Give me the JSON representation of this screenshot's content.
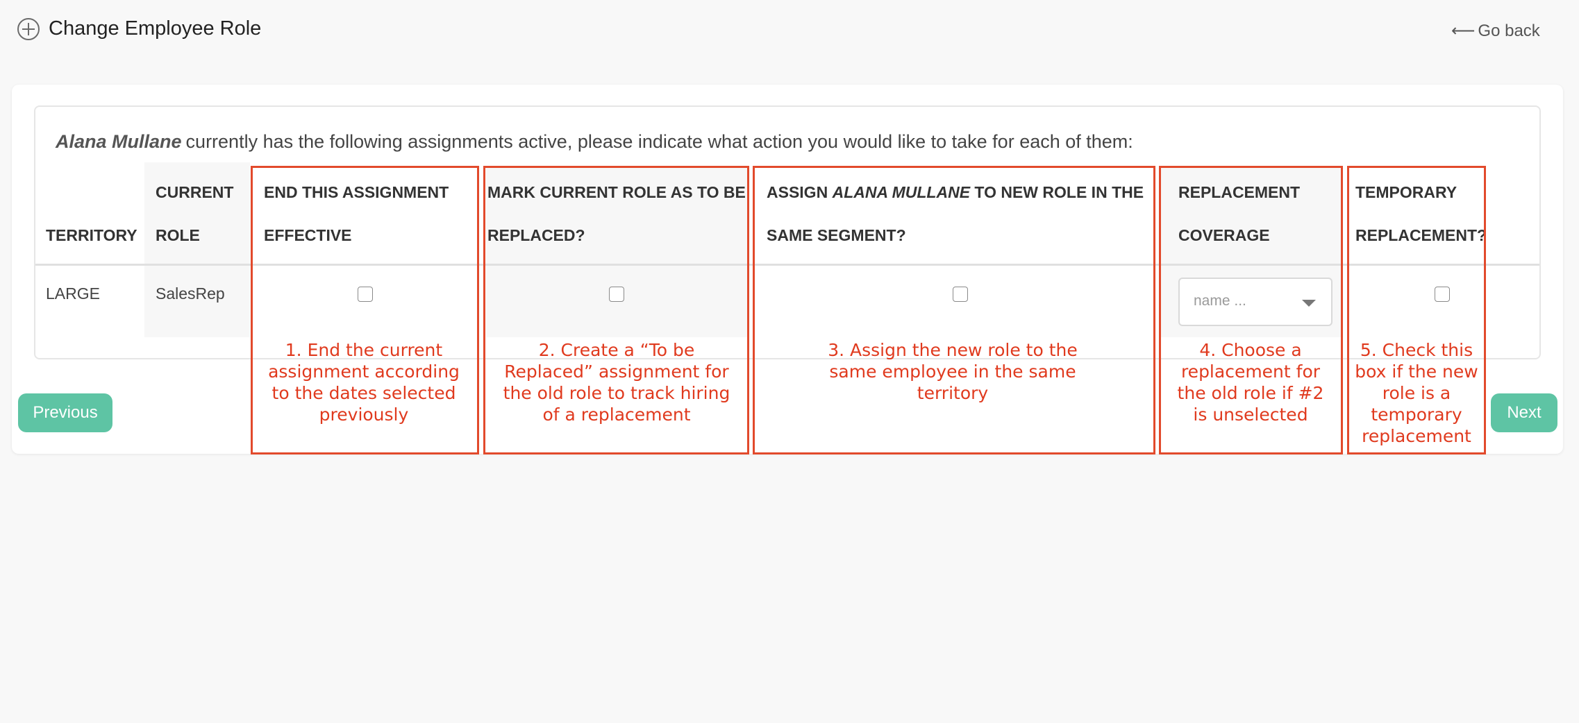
{
  "header": {
    "title": "Change Employee Role",
    "go_back": "Go back",
    "go_back_arrow": "⟵"
  },
  "intro": {
    "employee_name": "Alana Mullane",
    "text": "currently has the following assignments active, please indicate what action you would like to take for each of them:"
  },
  "table": {
    "headers": {
      "territory": "TERRITORY",
      "current_role_l1": "CURRENT",
      "current_role_l2": "ROLE",
      "end_assignment_l1": "END THIS ASSIGNMENT",
      "end_assignment_l2": "EFFECTIVE",
      "mark_replaced_l1": "MARK CURRENT ROLE AS TO BE",
      "mark_replaced_l2": "REPLACED?",
      "assign_l1_pre": "ASSIGN ",
      "assign_l1_name": "ALANA MULLANE",
      "assign_l1_post": " TO NEW ROLE IN THE",
      "assign_l2": "SAME SEGMENT?",
      "replacement_l1": "REPLACEMENT",
      "replacement_l2": "COVERAGE",
      "temporary_l1": "TEMPORARY",
      "temporary_l2": "REPLACEMENT?"
    },
    "row": {
      "territory": "LARGE",
      "current_role": "SalesRep",
      "end_assignment_checked": false,
      "mark_replaced_checked": false,
      "assign_checked": false,
      "replacement_placeholder": "name ...",
      "temporary_checked": false
    }
  },
  "annotations": {
    "a1": "1. End the current assignment according to the dates selected previously",
    "a2": "2. Create a “To be Replaced” assignment for the old role to track hiring of a replacement",
    "a3": "3. Assign the new role to the same employee in the same territory",
    "a4": "4. Choose a replacement for the old role if  #2 is unselected",
    "a5": "5. Check this box if the new role is a temporary replacement"
  },
  "buttons": {
    "previous": "Previous",
    "next": "Next"
  },
  "colors": {
    "accent": "#5ec4a4",
    "annotation": "#e24a2c"
  }
}
